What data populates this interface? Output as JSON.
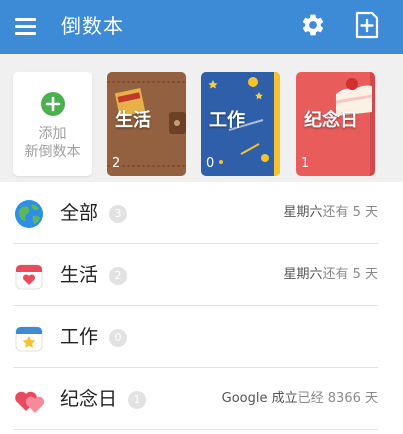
{
  "app": {
    "title": "倒数本"
  },
  "toolbar": {
    "menu_icon": "menu-icon",
    "settings_icon": "gear-icon",
    "add_icon": "add-book-icon"
  },
  "shelf": {
    "add_card": {
      "line1": "添加",
      "line2": "新倒数本"
    },
    "books": [
      {
        "name": "生活",
        "count": "2",
        "cover": "brown-leather"
      },
      {
        "name": "工作",
        "count": "0",
        "cover": "blue-stars"
      },
      {
        "name": "纪念日",
        "count": "1",
        "cover": "red-cake"
      }
    ]
  },
  "list": [
    {
      "name": "全部",
      "count": "3",
      "info_highlight": "星期六",
      "info_rest": "还有 5 天",
      "icon": "globe-icon"
    },
    {
      "name": "生活",
      "count": "2",
      "info_highlight": "星期六",
      "info_rest": "还有 5 天",
      "icon": "calendar-heart-icon"
    },
    {
      "name": "工作",
      "count": "0",
      "info_highlight": "",
      "info_rest": "",
      "icon": "calendar-star-icon"
    },
    {
      "name": "纪念日",
      "count": "1",
      "info_highlight": "Google 成立",
      "info_rest": "已经 8366 天",
      "icon": "hearts-icon"
    }
  ],
  "colors": {
    "appbar": "#3d8ad6",
    "accent_green": "#4caf50",
    "book_brown": "#8b5a3c",
    "book_blue": "#2e5fa8",
    "book_red": "#e85c5c"
  }
}
